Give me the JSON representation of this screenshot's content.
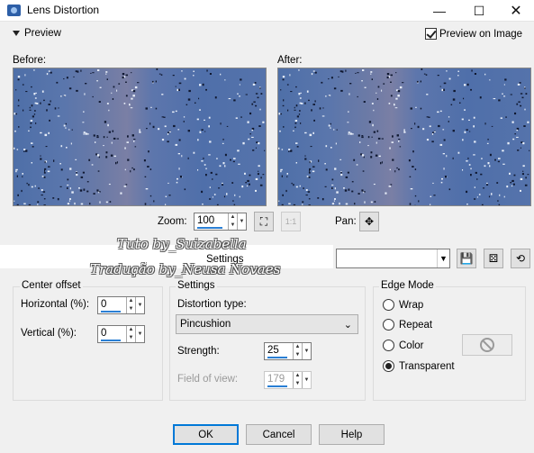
{
  "window": {
    "title": "Lens Distortion",
    "minimize": "—",
    "maximize": "☐",
    "close": "✕"
  },
  "preview": {
    "toggle_label": "Preview",
    "checkbox_label": "Preview on Image",
    "checked": true,
    "before_label": "Before:",
    "after_label": "After:"
  },
  "zoom": {
    "label": "Zoom:",
    "value": "100",
    "pan_label": "Pan:"
  },
  "watermark": {
    "line1": "Tuto by_Suizabella",
    "line2": "Tradução by_Neusa Novaes"
  },
  "presets": {
    "settings_label": "Settings",
    "value": ""
  },
  "center_offset": {
    "title": "Center offset",
    "horizontal_label": "Horizontal (%):",
    "horizontal_value": "0",
    "vertical_label": "Vertical (%):",
    "vertical_value": "0"
  },
  "settings": {
    "title": "Settings",
    "distortion_type_label": "Distortion type:",
    "distortion_type_value": "Pincushion",
    "strength_label": "Strength:",
    "strength_value": "25",
    "fov_label": "Field of view:",
    "fov_value": "179"
  },
  "edge_mode": {
    "title": "Edge Mode",
    "options": [
      "Wrap",
      "Repeat",
      "Color",
      "Transparent"
    ],
    "selected": "Transparent"
  },
  "buttons": {
    "ok": "OK",
    "cancel": "Cancel",
    "help": "Help"
  },
  "colors": {
    "accent": "#0078d7",
    "image_base": "#5673aa",
    "group_border": "#dcdcdc"
  }
}
